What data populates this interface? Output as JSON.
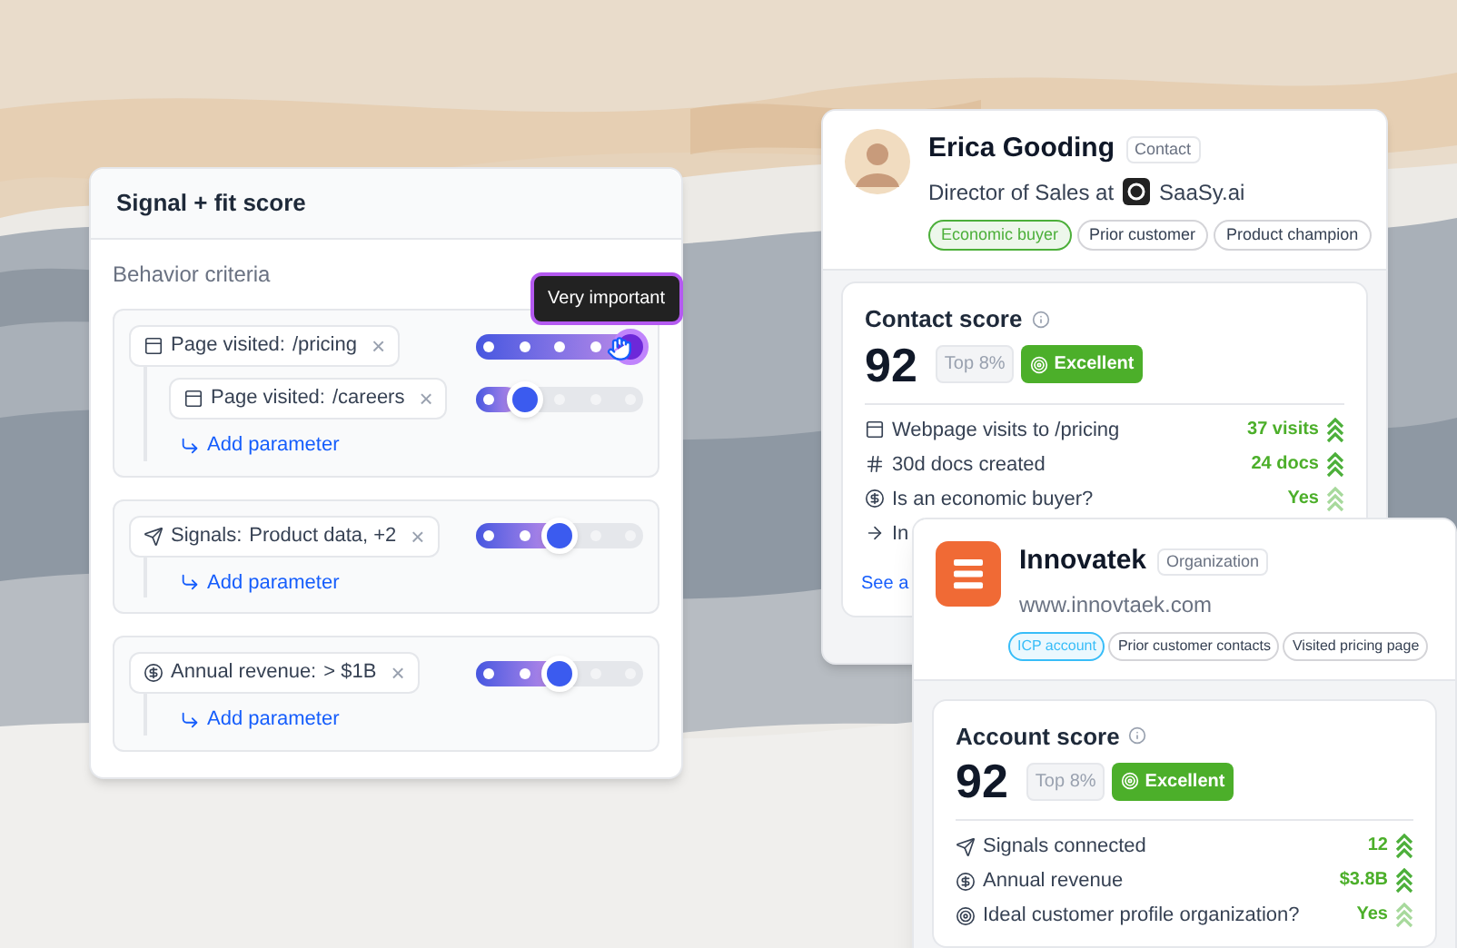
{
  "score_panel": {
    "title": "Signal + fit score",
    "section": "Behavior criteria",
    "tooltip": "Very important",
    "criteria": [
      {
        "kind": "page",
        "label": "Page visited:",
        "value": "/pricing",
        "remove": "×",
        "level": 1,
        "children": [
          {
            "kind": "page",
            "label": "Page visited:",
            "value": "/careers",
            "remove": "×",
            "level": 0.25
          }
        ],
        "add": "Add parameter"
      },
      {
        "kind": "signals",
        "label": "Signals:",
        "value": "Product data, +2",
        "remove": "×",
        "level": 0.5,
        "add": "Add parameter"
      },
      {
        "kind": "revenue",
        "label": "Annual revenue:",
        "value": "> $1B",
        "remove": "×",
        "level": 0.5,
        "add": "Add parameter"
      }
    ]
  },
  "contact_card": {
    "name": "Erica Gooding",
    "type": "Contact",
    "role": "Director of Sales at",
    "company": "SaaSy.ai",
    "tags": [
      {
        "label": "Economic buyer",
        "color": "#4caf3a"
      },
      {
        "label": "Prior customer",
        "color": "#d4d4d8"
      },
      {
        "label": "Product champion",
        "color": "#d4d4d8"
      }
    ],
    "score": {
      "title": "Contact score",
      "value": "92",
      "rank": "Top 8%",
      "grade": "Excellent",
      "rows": [
        {
          "kind": "page",
          "label": "Webpage visits to /pricing",
          "value": "37 visits",
          "strong": true
        },
        {
          "kind": "hash",
          "label": "30d docs created",
          "value": "24 docs",
          "strong": true
        },
        {
          "kind": "revenue",
          "label": "Is an economic buyer?",
          "value": "Yes",
          "strong": false
        },
        {
          "kind": "arrow",
          "label": "In"
        }
      ],
      "link": "See a"
    }
  },
  "org_card": {
    "name": "Innovatek",
    "type": "Organization",
    "url": "www.innovtaek.com",
    "tags": [
      {
        "label": "ICP account",
        "color": "#38bdf8"
      },
      {
        "label": "Prior customer contacts",
        "color": "#d4d4d8"
      },
      {
        "label": "Visited pricing page",
        "color": "#d4d4d8"
      }
    ],
    "score": {
      "title": "Account score",
      "value": "92",
      "rank": "Top 8%",
      "grade": "Excellent",
      "rows": [
        {
          "kind": "signals",
          "label": "Signals connected",
          "value": "12",
          "strong": true
        },
        {
          "kind": "revenue",
          "label": "Annual revenue",
          "value": "$3.8B",
          "strong": true
        },
        {
          "kind": "target",
          "label": "Ideal customer profile organization?",
          "value": "Yes",
          "strong": false
        }
      ]
    }
  }
}
